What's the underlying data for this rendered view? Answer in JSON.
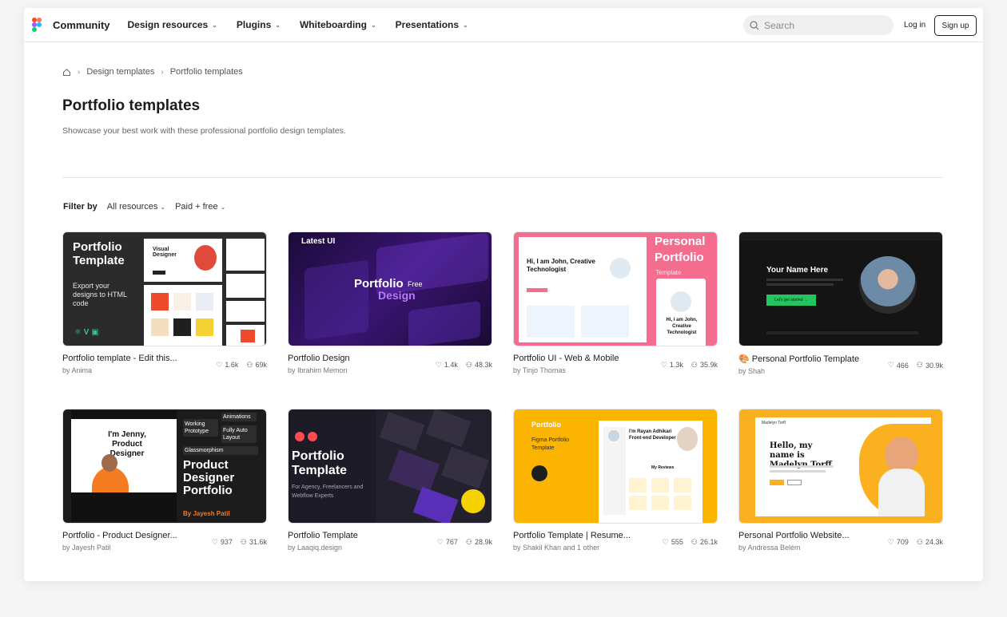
{
  "nav": {
    "brand": "Community",
    "items": [
      {
        "label": "Design resources"
      },
      {
        "label": "Plugins"
      },
      {
        "label": "Whiteboarding"
      },
      {
        "label": "Presentations"
      }
    ],
    "search_placeholder": "Search",
    "login": "Log in",
    "signup": "Sign up"
  },
  "breadcrumb": [
    "Design templates",
    "Portfolio templates"
  ],
  "page": {
    "title": "Portfolio templates",
    "subtitle": "Showcase your best work with these professional portfolio design templates."
  },
  "filters": {
    "label": "Filter by",
    "resources": "All resources",
    "pricing": "Paid + free"
  },
  "cards": [
    {
      "title": "Portfolio template - Edit this...",
      "author": "by Anima",
      "likes": "1.6k",
      "users": "69k",
      "thumb": {
        "big": "Portfolio Template",
        "small": "Export your designs to HTML code",
        "card": "Visual Designer"
      }
    },
    {
      "title": "Portfolio Design",
      "author": "by Ibrahim Memon",
      "likes": "1.4k",
      "users": "48.3k",
      "thumb": {
        "top": "Latest UI",
        "main": "Portfolio",
        "free": "Free",
        "design": "Design"
      }
    },
    {
      "title": "Portfolio UI - Web & Mobile",
      "author": "by Tinjo Thomas",
      "likes": "1.3k",
      "users": "35.9k",
      "thumb": {
        "hi": "Hi, I am John, Creative Technologist",
        "side": "Personal Portfolio",
        "tag": "Template",
        "mobile": "Hi, I am John, Creative Technologist"
      }
    },
    {
      "title": "🎨 Personal Portfolio Template",
      "author": "by Shah",
      "likes": "466",
      "users": "30.9k",
      "thumb": {
        "name": "Your Name Here",
        "btn": "Let's get started →"
      }
    },
    {
      "title": "Portfolio - Product Designer...",
      "author": "by Jayesh Patil",
      "likes": "937",
      "users": "31.6k",
      "thumb": {
        "hi": "I'm Jenny, Product Designer",
        "tag1": "Working Prototype",
        "tag2": "Animations",
        "tag3": "Fully Auto Layout",
        "tag4": "Glassmorphism",
        "big": "Product Designer Portfolio",
        "by": "By Jayesh Patil"
      }
    },
    {
      "title": "Portfolio Template",
      "author": "by Laaqiq.design",
      "likes": "767",
      "users": "28.9k",
      "thumb": {
        "big": "Portfolio Template",
        "small": "For Agency, Freelancers and Webflow Experts"
      }
    },
    {
      "title": "Portfolio Template | Resume...",
      "author": "by Shakil Khan and 1 other",
      "likes": "555",
      "users": "26.1k",
      "thumb": {
        "logo": "Portfolio",
        "sub": "Figma Portfolio Template",
        "head": "I'm Rayan Adhikari Front-end Developer",
        "rev": "My Reviews"
      }
    },
    {
      "title": "Personal Portfolio Website...",
      "author": "by Andressa Belém",
      "likes": "709",
      "users": "24.3k",
      "thumb": {
        "hello": "Hello, my name is Madelyn Torff",
        "logo": "Madelyn Torff"
      }
    }
  ]
}
